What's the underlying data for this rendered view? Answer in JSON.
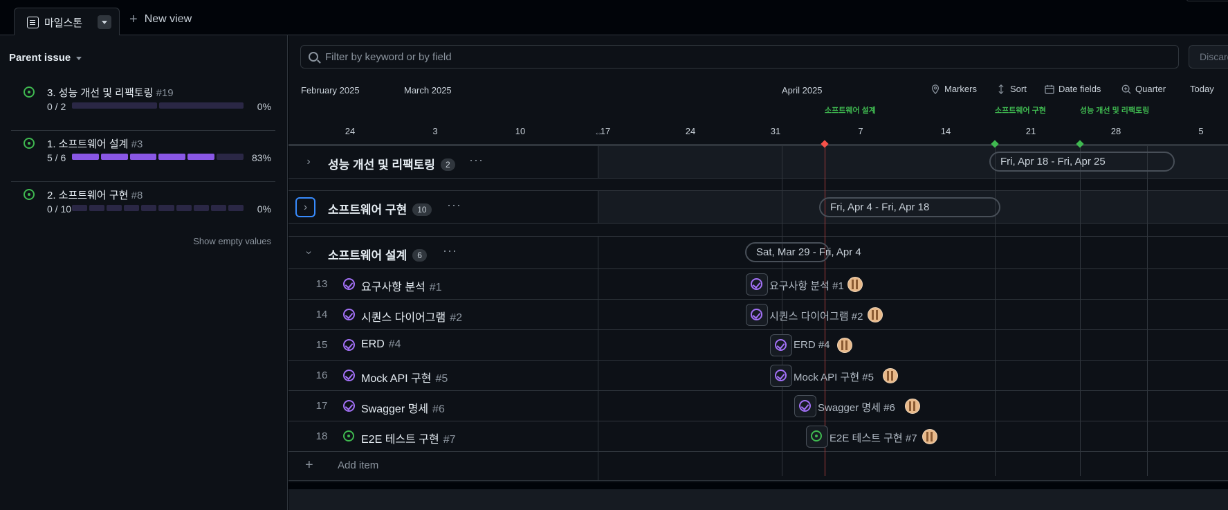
{
  "topbar": {
    "active_view": "마일스톤",
    "new_view": "New view"
  },
  "left_panel": {
    "header": "Parent issue",
    "milestones": [
      {
        "title": "3. 성능 개선 및 리팩토링",
        "number": "#19",
        "count": "0 / 2",
        "percent": "0%",
        "segments": 2,
        "done": 0
      },
      {
        "title": "1. 소프트웨어 설계",
        "number": "#3",
        "count": "5 / 6",
        "percent": "83%",
        "segments": 6,
        "done": 5
      },
      {
        "title": "2. 소프트웨어 구현",
        "number": "#8",
        "count": "0 / 10",
        "percent": "0%",
        "segments": 10,
        "done": 0
      }
    ],
    "show_empty": "Show empty values"
  },
  "toolbar": {
    "filter_placeholder": "Filter by keyword or by field",
    "discard": "Discard",
    "markers": "Markers",
    "sort": "Sort",
    "date_fields": "Date fields",
    "zoom": "Quarter",
    "today": "Today"
  },
  "timeline": {
    "months": [
      "February 2025",
      "March 2025",
      "April 2025"
    ],
    "days": [
      "24",
      "3",
      "10",
      "17",
      "24",
      "31",
      "7",
      "14",
      "21",
      "28",
      "5"
    ],
    "milestone_markers": [
      "소프트웨어 설계",
      "소프트웨어 구현",
      "성능 개선 및 리팩토링"
    ]
  },
  "groups": [
    {
      "title": "성능 개선 및 리팩토링",
      "count": "2",
      "range": "Fri, Apr 18 - Fri, Apr 25",
      "expanded": false
    },
    {
      "title": "소프트웨어 구현",
      "count": "10",
      "range": "Fri, Apr 4 - Fri, Apr 18",
      "expanded": false
    },
    {
      "title": "소프트웨어 설계",
      "count": "6",
      "range": "Sat, Mar 29 - Fri, Apr 4",
      "expanded": true
    }
  ],
  "items": [
    {
      "row": "13",
      "title": "요구사항 분석",
      "number": "#1",
      "state": "closed",
      "bar_label": "요구사항 분석 #1"
    },
    {
      "row": "14",
      "title": "시퀀스 다이어그램",
      "number": "#2",
      "state": "closed",
      "bar_label": "시퀀스 다이어그램 #2"
    },
    {
      "row": "15",
      "title": "ERD",
      "number": "#4",
      "state": "closed",
      "bar_label": "ERD #4"
    },
    {
      "row": "16",
      "title": "Mock API 구현",
      "number": "#5",
      "state": "closed",
      "bar_label": "Mock API 구현 #5"
    },
    {
      "row": "17",
      "title": "Swagger 명세",
      "number": "#6",
      "state": "closed",
      "bar_label": "Swagger 명세 #6"
    },
    {
      "row": "18",
      "title": "E2E 테스트 구현",
      "number": "#7",
      "state": "open",
      "bar_label": "E2E 테스트 구현 #7"
    }
  ],
  "add_item": "Add item",
  "colors": {
    "open": "#3fb950",
    "closed": "#a371f7",
    "today_line": "#f85149",
    "accent": "#388bfd"
  }
}
